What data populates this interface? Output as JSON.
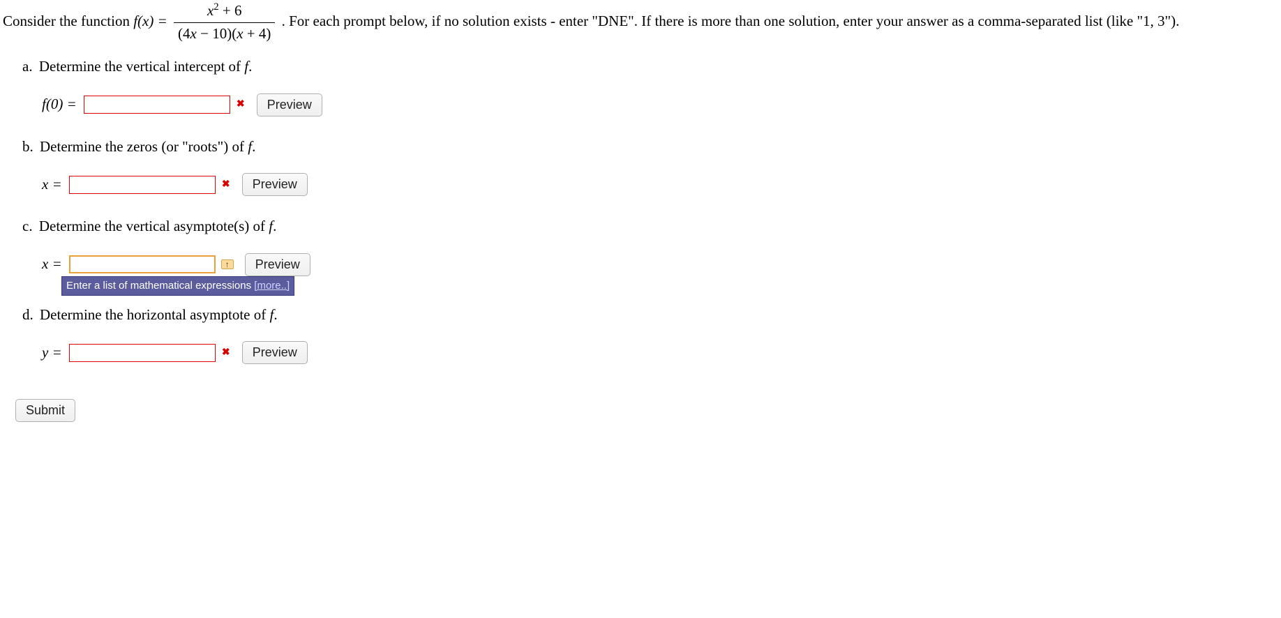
{
  "intro": {
    "prefix": "Consider the function ",
    "func_lhs": "f(x) = ",
    "numerator": "x² + 6",
    "denominator": "(4x − 10)(x + 4)",
    "suffix": ". For each prompt below, if no solution exists - enter \"DNE\". If there is more than one solution, enter your answer as a comma-separated list (like \"1, 3\")."
  },
  "parts": {
    "a": {
      "label": "a.",
      "text": "Determine the vertical intercept of f.",
      "lhs": "f(0) = ",
      "value": "",
      "status": "wrong",
      "preview": "Preview"
    },
    "b": {
      "label": "b.",
      "text": "Determine the zeros (or \"roots\") of f.",
      "lhs": "x = ",
      "value": "",
      "status": "wrong",
      "preview": "Preview"
    },
    "c": {
      "label": "c.",
      "text": "Determine the vertical asymptote(s) of f.",
      "lhs": "x = ",
      "value": "",
      "status": "focused",
      "preview": "Preview",
      "tooltip": "Enter a list of mathematical expressions ",
      "tooltip_more": "[more..]"
    },
    "d": {
      "label": "d.",
      "text": "Determine the horizontal asymptote of f.",
      "lhs": "y = ",
      "value": "",
      "status": "wrong",
      "preview": "Preview"
    }
  },
  "submit_label": "Submit"
}
